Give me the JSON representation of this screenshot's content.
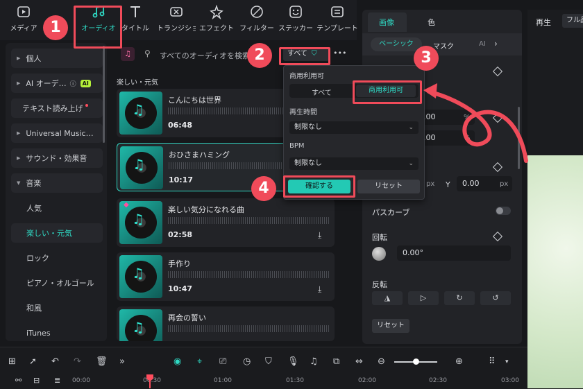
{
  "toolbar": {
    "items": [
      {
        "label": "メディア",
        "icon": "media-icon"
      },
      {
        "label": "オーディオ",
        "icon": "music-note-icon"
      },
      {
        "label": "タイトル",
        "icon": "title-t-icon"
      },
      {
        "label": "トランジション",
        "icon": "transition-icon"
      },
      {
        "label": "エフェクト",
        "icon": "effect-star-icon"
      },
      {
        "label": "フィルター",
        "icon": "filter-icon"
      },
      {
        "label": "ステッカー",
        "icon": "sticker-icon"
      },
      {
        "label": "テンプレート",
        "icon": "template-icon"
      }
    ]
  },
  "sidebar": {
    "items": [
      {
        "label": "個人"
      },
      {
        "label": "AI オーデ…",
        "badge": "AI"
      },
      {
        "label": "テキスト読み上げ"
      },
      {
        "label": "Universal Music…"
      },
      {
        "label": "サウンド・効果音"
      },
      {
        "label": "音楽"
      },
      {
        "label": "人気"
      },
      {
        "label": "楽しい・元気"
      },
      {
        "label": "ロック"
      },
      {
        "label": "ピアノ・オルゴール"
      },
      {
        "label": "和風"
      },
      {
        "label": "iTunes"
      }
    ]
  },
  "search": {
    "placeholder": "すべてのオーディオを検索",
    "filter_label": "すべて",
    "more": "•••"
  },
  "list": {
    "section_title": "楽しい・元気",
    "tracks": [
      {
        "title": "こんにちは世界",
        "duration": "06:48"
      },
      {
        "title": "おひさまハミング",
        "duration": "10:17"
      },
      {
        "title": "楽しい気分になれる曲",
        "duration": "02:58"
      },
      {
        "title": "手作り",
        "duration": "10:47"
      },
      {
        "title": "再会の誓い",
        "duration": ""
      }
    ]
  },
  "filter_popup": {
    "license_label": "商用利用可",
    "option_all": "すべて",
    "option_commercial": "商用利用可",
    "duration_label": "再生時間",
    "duration_value": "制限なし",
    "bpm_label": "BPM",
    "bpm_value": "制限なし",
    "confirm": "確認する",
    "reset": "リセット"
  },
  "props": {
    "tab_image": "画像",
    "tab_color": "色",
    "subtab_basic": "ベーシック",
    "subtab_mask": "マスク",
    "subtab_ai": "AI",
    "scale_x": ".00",
    "scale_y": ".00",
    "percent": "%",
    "pos_x_unit": "px",
    "pos_y_label": "Y",
    "pos_y_value": "0.00",
    "pos_y_unit": "px",
    "bezier": "パスカーブ",
    "rotate_label": "回転",
    "rotate_value": "0.00°",
    "flip_label": "反転",
    "reset": "リセット"
  },
  "player": {
    "label": "再生",
    "quality": "フル品"
  },
  "timeline": {
    "ruler": [
      "00:00",
      "00:30",
      "01:00",
      "01:30",
      "02:00",
      "02:30",
      "03:00"
    ]
  },
  "annotations": {
    "n1": "1",
    "n2": "2",
    "n3": "3",
    "n4": "4"
  },
  "colors": {
    "accent": "#2fd9c4",
    "annotation": "#f04b5a"
  }
}
